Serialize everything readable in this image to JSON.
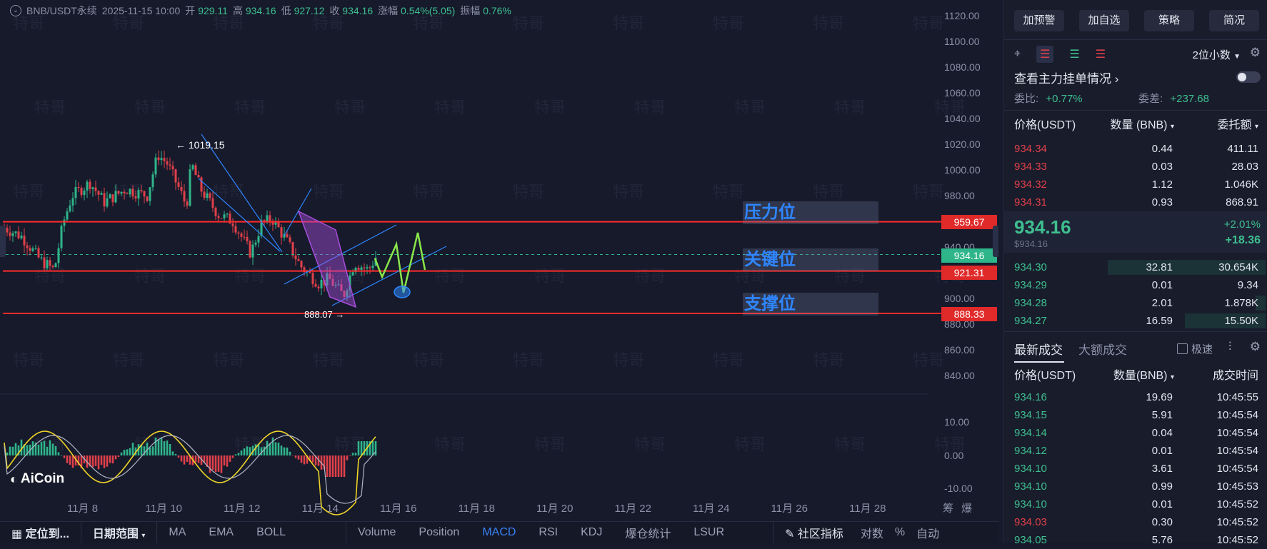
{
  "header": {
    "symbol": "BNB/USDT永续",
    "datetime": "2025-11-15 10:00",
    "open_label": "开",
    "open": "929.11",
    "high_label": "高",
    "high": "934.16",
    "low_label": "低",
    "low": "927.12",
    "close_label": "收",
    "close": "934.16",
    "change_label": "涨幅",
    "change": "0.54%(5.05)",
    "amp_label": "振幅",
    "amp": "0.76%"
  },
  "watermark": "特哥",
  "chart": {
    "price_ticks": [
      "1120.00",
      "1100.00",
      "1080.00",
      "1060.00",
      "1040.00",
      "1020.00",
      "1000.00",
      "980.00",
      "960.00",
      "940.00",
      "920.00",
      "900.00",
      "880.00",
      "860.00",
      "840.00"
    ],
    "macd_ticks": [
      "10.00",
      "0.00",
      "-10.00"
    ],
    "date_ticks": [
      "11月 8",
      "11月 10",
      "11月 12",
      "11月 14",
      "11月 16",
      "11月 18",
      "11月 20",
      "11月 22",
      "11月 24",
      "11月 26",
      "11月 28"
    ],
    "date_right": [
      "筹",
      "爆"
    ],
    "high_marker": "← 1019.15",
    "low_marker": "888.07 →",
    "levels": [
      {
        "label": "压力位",
        "price": "959.67"
      },
      {
        "label": "关键位",
        "price": "921.31"
      },
      {
        "label": "支撑位",
        "price": "888.33"
      }
    ],
    "current_price": "934.16",
    "colors": {
      "up": "#2fb58a",
      "down": "#e0404a",
      "level": "#ff2a2a",
      "trend": "#2f86ff",
      "zigzag": "#8be64a",
      "channel": "#a64ddb"
    }
  },
  "logo": "AiCoin",
  "bottom_bar": {
    "locate": "定位到...",
    "date_range": "日期范围",
    "indicators": [
      "MA",
      "EMA",
      "BOLL"
    ],
    "subs": [
      "Volume",
      "Position",
      "MACD",
      "RSI",
      "KDJ",
      "爆仓统计",
      "LSUR"
    ],
    "active": "MACD",
    "community": "社区指标",
    "right": [
      "对数",
      "%",
      "自动"
    ]
  },
  "side": {
    "top_buttons": [
      "加预警",
      "加自选",
      "策略",
      "简况"
    ],
    "decimal": "2位小数",
    "main_orders": "查看主力挂单情况",
    "ratio_label": "委比:",
    "ratio": "+0.77%",
    "diff_label": "委差:",
    "diff": "+237.68",
    "book_headers": [
      "价格(USDT)",
      "数量 (BNB)",
      "委托额"
    ],
    "asks": [
      {
        "price": "934.34",
        "qty": "0.44",
        "amt": "411.11"
      },
      {
        "price": "934.33",
        "qty": "0.03",
        "amt": "28.03"
      },
      {
        "price": "934.32",
        "qty": "1.12",
        "amt": "1.046K"
      },
      {
        "price": "934.31",
        "qty": "0.93",
        "amt": "868.91"
      }
    ],
    "last": {
      "price": "934.16",
      "usd": "$934.16",
      "pct": "+2.01%",
      "abs": "+18.36"
    },
    "bids": [
      {
        "price": "934.30",
        "qty": "32.81",
        "amt": "30.654K",
        "depth": 0.82
      },
      {
        "price": "934.29",
        "qty": "0.01",
        "amt": "9.34",
        "depth": 0
      },
      {
        "price": "934.28",
        "qty": "2.01",
        "amt": "1.878K",
        "depth": 0.05
      },
      {
        "price": "934.27",
        "qty": "16.59",
        "amt": "15.50K",
        "depth": 0.42
      }
    ],
    "trade_tabs": [
      "最新成交",
      "大额成交"
    ],
    "fast_label": "极速",
    "trade_headers": [
      "价格(USDT)",
      "数量(BNB)",
      "成交时间"
    ],
    "trades": [
      {
        "price": "934.16",
        "qty": "19.69",
        "time": "10:45:55",
        "side": "buy"
      },
      {
        "price": "934.15",
        "qty": "5.91",
        "time": "10:45:54",
        "side": "buy"
      },
      {
        "price": "934.14",
        "qty": "0.04",
        "time": "10:45:54",
        "side": "buy"
      },
      {
        "price": "934.12",
        "qty": "0.01",
        "time": "10:45:54",
        "side": "buy"
      },
      {
        "price": "934.10",
        "qty": "3.61",
        "time": "10:45:54",
        "side": "buy"
      },
      {
        "price": "934.10",
        "qty": "0.99",
        "time": "10:45:53",
        "side": "buy"
      },
      {
        "price": "934.10",
        "qty": "0.01",
        "time": "10:45:52",
        "side": "buy"
      },
      {
        "price": "934.03",
        "qty": "0.30",
        "time": "10:45:52",
        "side": "sell"
      },
      {
        "price": "934.05",
        "qty": "5.76",
        "time": "10:45:52",
        "side": "buy"
      }
    ]
  }
}
